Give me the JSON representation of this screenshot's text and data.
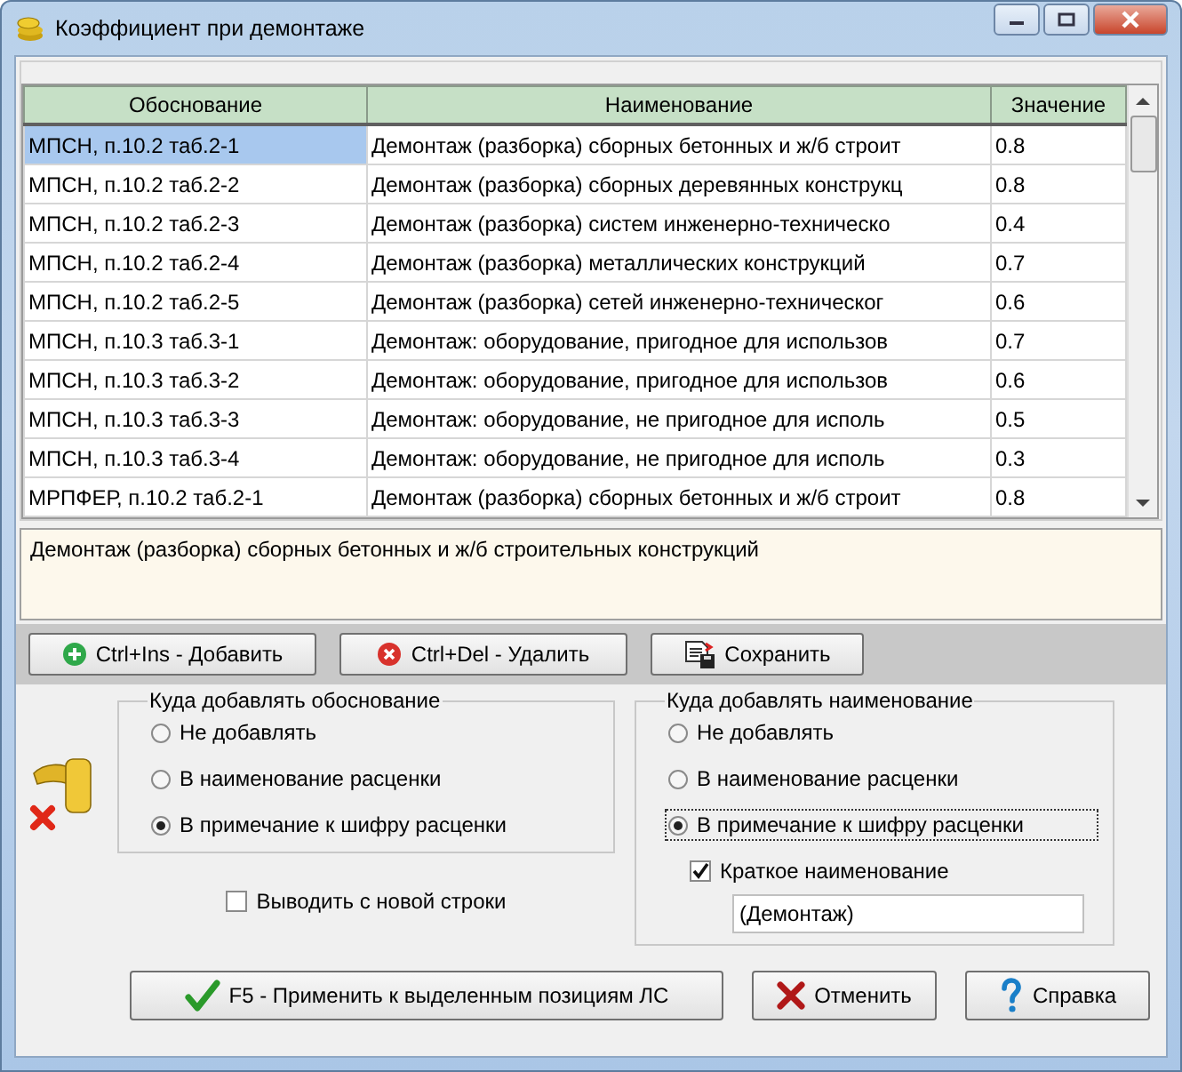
{
  "window": {
    "title": "Коэффициент при демонтаже"
  },
  "table": {
    "columns": [
      "Обоснование",
      "Наименование",
      "Значение"
    ],
    "rows": [
      {
        "cells": [
          "МПСН, п.10.2 таб.2-1",
          "Демонтаж (разборка) сборных бетонных и ж/б строит",
          "0.8"
        ],
        "selected": true
      },
      {
        "cells": [
          "МПСН, п.10.2 таб.2-2",
          "Демонтаж (разборка) сборных деревянных конструкц",
          "0.8"
        ],
        "selected": false
      },
      {
        "cells": [
          "МПСН, п.10.2 таб.2-3",
          "Демонтаж (разборка) систем инженерно-техническо",
          "0.4"
        ],
        "selected": false
      },
      {
        "cells": [
          "МПСН, п.10.2 таб.2-4",
          "Демонтаж (разборка) металлических конструкций",
          "0.7"
        ],
        "selected": false
      },
      {
        "cells": [
          "МПСН, п.10.2 таб.2-5",
          "Демонтаж (разборка) сетей инженерно-техническог",
          "0.6"
        ],
        "selected": false
      },
      {
        "cells": [
          "МПСН, п.10.3 таб.3-1",
          "Демонтаж: оборудование, пригодное для использов",
          "0.7"
        ],
        "selected": false
      },
      {
        "cells": [
          "МПСН, п.10.3 таб.3-2",
          "Демонтаж: оборудование, пригодное для использов",
          "0.6"
        ],
        "selected": false
      },
      {
        "cells": [
          "МПСН, п.10.3 таб.3-3",
          "Демонтаж: оборудование, не пригодное для исполь",
          "0.5"
        ],
        "selected": false
      },
      {
        "cells": [
          "МПСН, п.10.3 таб.3-4",
          "Демонтаж: оборудование, не пригодное для исполь",
          "0.3"
        ],
        "selected": false
      },
      {
        "cells": [
          "МРПФЕР, п.10.2 таб.2-1",
          "Демонтаж (разборка) сборных бетонных и ж/б строит",
          "0.8"
        ],
        "selected": false
      }
    ]
  },
  "description": "Демонтаж (разборка) сборных бетонных и ж/б строительных конструкций",
  "toolbar": [
    {
      "label": "Ctrl+Ins - Добавить"
    },
    {
      "label": "Ctrl+Del - Удалить"
    },
    {
      "label": "Сохранить"
    }
  ],
  "basis_group": {
    "title": "Куда добавлять обоснование",
    "options": [
      {
        "label": "Не добавлять",
        "selected": false,
        "focused": false
      },
      {
        "label": "В наименование расценки",
        "selected": false,
        "focused": false
      },
      {
        "label": "В примечание к шифру расценки",
        "selected": true,
        "focused": false
      }
    ]
  },
  "new_line": {
    "label": "Выводить с новой строки",
    "checked": false
  },
  "name_group": {
    "title": "Куда добавлять наименование",
    "options": [
      {
        "label": "Не добавлять",
        "selected": false,
        "focused": false
      },
      {
        "label": "В наименование расценки",
        "selected": false,
        "focused": false
      },
      {
        "label": "В примечание к шифру расценки",
        "selected": true,
        "focused": true
      }
    ],
    "short_name": {
      "label": "Краткое наименование",
      "checked": true
    },
    "short_name_value": "(Демонтаж)"
  },
  "buttons": [
    {
      "label": "F5 - Применить к выделенным позициям ЛС"
    },
    {
      "label": "Отменить"
    },
    {
      "label": "Справка"
    }
  ]
}
